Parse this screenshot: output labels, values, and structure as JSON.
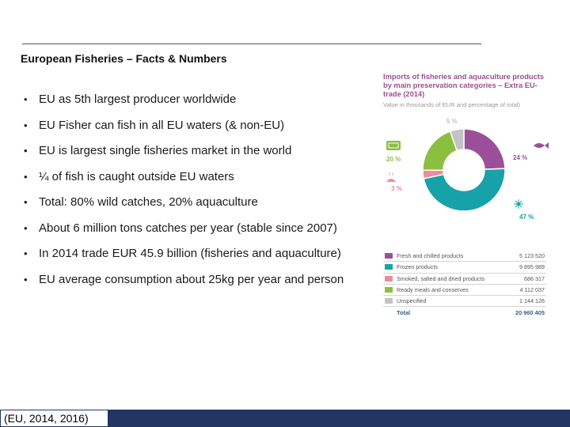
{
  "slide": {
    "title": "European Fisheries – Facts & Numbers",
    "bullets": [
      "EU as 5th largest producer worldwide",
      "EU Fisher can fish in all EU waters (& non-EU)",
      "EU is largest single fisheries market in the world",
      "¼ of fish is caught outside EU waters",
      "Total: 80% wild catches, 20% aquaculture",
      "About 6 million tons catches per year (stable since 2007)",
      "In 2014 trade EUR 45.9 billion (fisheries and aquaculture)",
      "EU average consumption about 25kg per year and person"
    ],
    "source": "(EU, 2014, 2016)"
  },
  "infographic": {
    "title": "Imports of fisheries and aquaculture products by main preservation categories – Extra EU-trade (2014)",
    "subtitle": "Value in thousands of EUR and percentage of total)",
    "legend": [
      {
        "label": "Fresh and chilled products",
        "value": "5 123 520",
        "color": "#9b4f99"
      },
      {
        "label": "Frozen products",
        "value": "9 895 989",
        "color": "#16a2a8"
      },
      {
        "label": "Smoked, salted and dried products",
        "value": "686 317",
        "color": "#ec8c9c"
      },
      {
        "label": "Ready meals and conserves",
        "value": "4 112 037",
        "color": "#8bbf3f"
      },
      {
        "label": "Unspecified",
        "value": "1 144 126",
        "color": "#c3c3c3"
      }
    ],
    "total": {
      "label": "Total",
      "value": "20 960 405"
    },
    "icons": [
      "fish-icon",
      "fish-icon",
      "shellfish-icon",
      "can-icon",
      "shrimp-icon"
    ]
  },
  "chart_data": {
    "type": "pie",
    "title": "Imports of fisheries and aquaculture products by main preservation categories – Extra EU-trade (2014)",
    "categories": [
      "Fresh and chilled products",
      "Frozen products",
      "Smoked, salted and dried products",
      "Ready meals and conserves",
      "Unspecified"
    ],
    "values": [
      5123520,
      9895989,
      686317,
      4112037,
      1144126
    ],
    "percent_labels": [
      "24 %",
      "47 %",
      "3 %",
      "20 %",
      "5 %"
    ],
    "colors": [
      "#9b4f99",
      "#16a2a8",
      "#ec8c9c",
      "#8bbf3f",
      "#c3c3c3"
    ],
    "donut": true,
    "legend": "bottom"
  }
}
